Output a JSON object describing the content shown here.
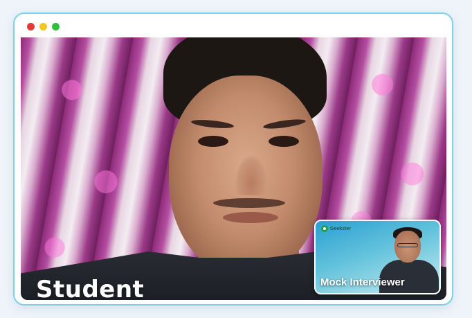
{
  "window": {
    "controls": {
      "close_color": "#e53935",
      "minimize_color": "#f3c623",
      "maximize_color": "#2fbf3c"
    },
    "border_color": "#7fd0ea"
  },
  "main_video": {
    "participant_label": "Student"
  },
  "pip_video": {
    "brand_logo_text": "Geekster",
    "participant_label": "Mock Interviewer"
  }
}
